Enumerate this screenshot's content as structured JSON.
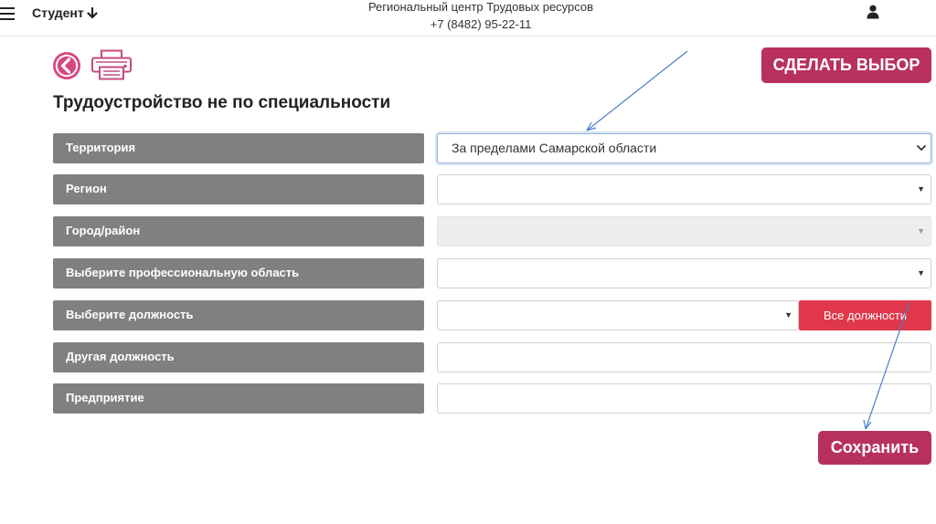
{
  "header": {
    "role_label": "Студент",
    "role_arrow": "🡓",
    "org_name": "Региональный центр Трудовых ресурсов",
    "phone": "+7 (8482) 95-22-11"
  },
  "toolbar": {
    "make_choice_label": "СДЕЛАТЬ ВЫБОР"
  },
  "page": {
    "title": "Трудоустройство не по специальности"
  },
  "form": {
    "territory": {
      "label": "Территория",
      "value": "За пределами Самарской области"
    },
    "region": {
      "label": "Регион",
      "value": ""
    },
    "city": {
      "label": "Город/район",
      "value": ""
    },
    "prof_area": {
      "label": "Выберите профессиональную область",
      "value": ""
    },
    "position": {
      "label": "Выберите должность",
      "value": "",
      "all_label": "Все должности"
    },
    "other_position": {
      "label": "Другая должность",
      "value": ""
    },
    "enterprise": {
      "label": "Предприятие",
      "value": ""
    }
  },
  "actions": {
    "save_label": "Сохранить"
  },
  "colors": {
    "accent": "#b8315e",
    "red_button": "#e0384a",
    "label_bg": "#808080"
  }
}
